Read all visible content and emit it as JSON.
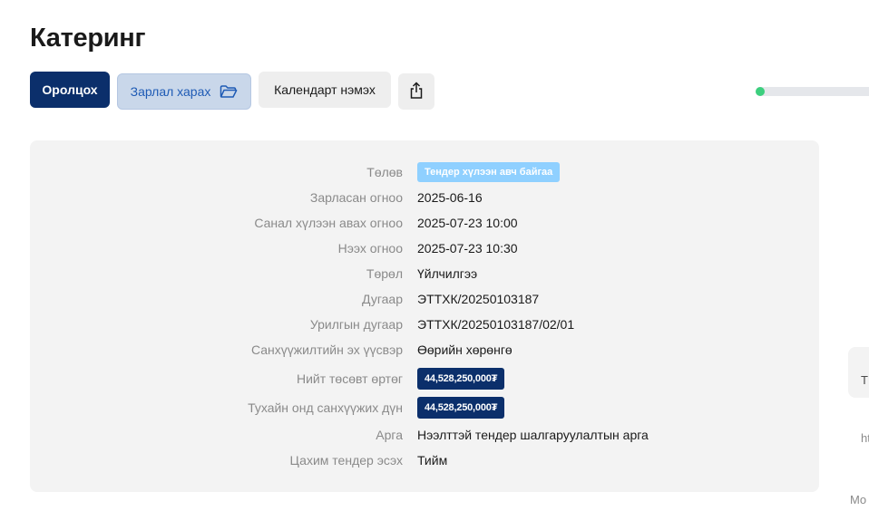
{
  "page": {
    "title": "Катеринг"
  },
  "actions": {
    "participate": "Оролцох",
    "view_notice": "Зарлал харах",
    "add_calendar": "Календарт нэмэх"
  },
  "progress": {
    "fraction": 0.0
  },
  "details": [
    {
      "label": "Төлөв",
      "value": "Тендер хүлээн авч байгаа",
      "kind": "status"
    },
    {
      "label": "Зарласан огноо",
      "value": "2025-06-16",
      "kind": "text"
    },
    {
      "label": "Санал хүлээн авах огноо",
      "value": "2025-07-23 10:00",
      "kind": "text"
    },
    {
      "label": "Нээх огноо",
      "value": "2025-07-23 10:30",
      "kind": "text"
    },
    {
      "label": "Төрөл",
      "value": "Үйлчилгээ",
      "kind": "text"
    },
    {
      "label": "Дугаар",
      "value": "ЭТТХК/20250103187",
      "kind": "text"
    },
    {
      "label": "Урилгын дугаар",
      "value": "ЭТТХК/20250103187/02/01",
      "kind": "text"
    },
    {
      "label": "Санхүүжилтийн эх үүсвэр",
      "value": "Өөрийн хөрөнгө",
      "kind": "text"
    },
    {
      "label": "Нийт төсөвт өртөг",
      "value": "44,528,250,000₮",
      "kind": "money"
    },
    {
      "label": "Тухайн онд санхүүжих дүн",
      "value": "44,528,250,000₮",
      "kind": "money"
    },
    {
      "label": "Арга",
      "value": "Нээлттэй тендер шалгаруулалтын арга",
      "kind": "text"
    },
    {
      "label": "Цахим тендер эсэх",
      "value": "Тийм",
      "kind": "text"
    }
  ],
  "side": {
    "t": "T",
    "h": "ht",
    "mo": "Mo"
  },
  "colors": {
    "primary": "#0b2f6b",
    "status_badge": "#8fd0ff",
    "progress": "#3ccf7e"
  }
}
